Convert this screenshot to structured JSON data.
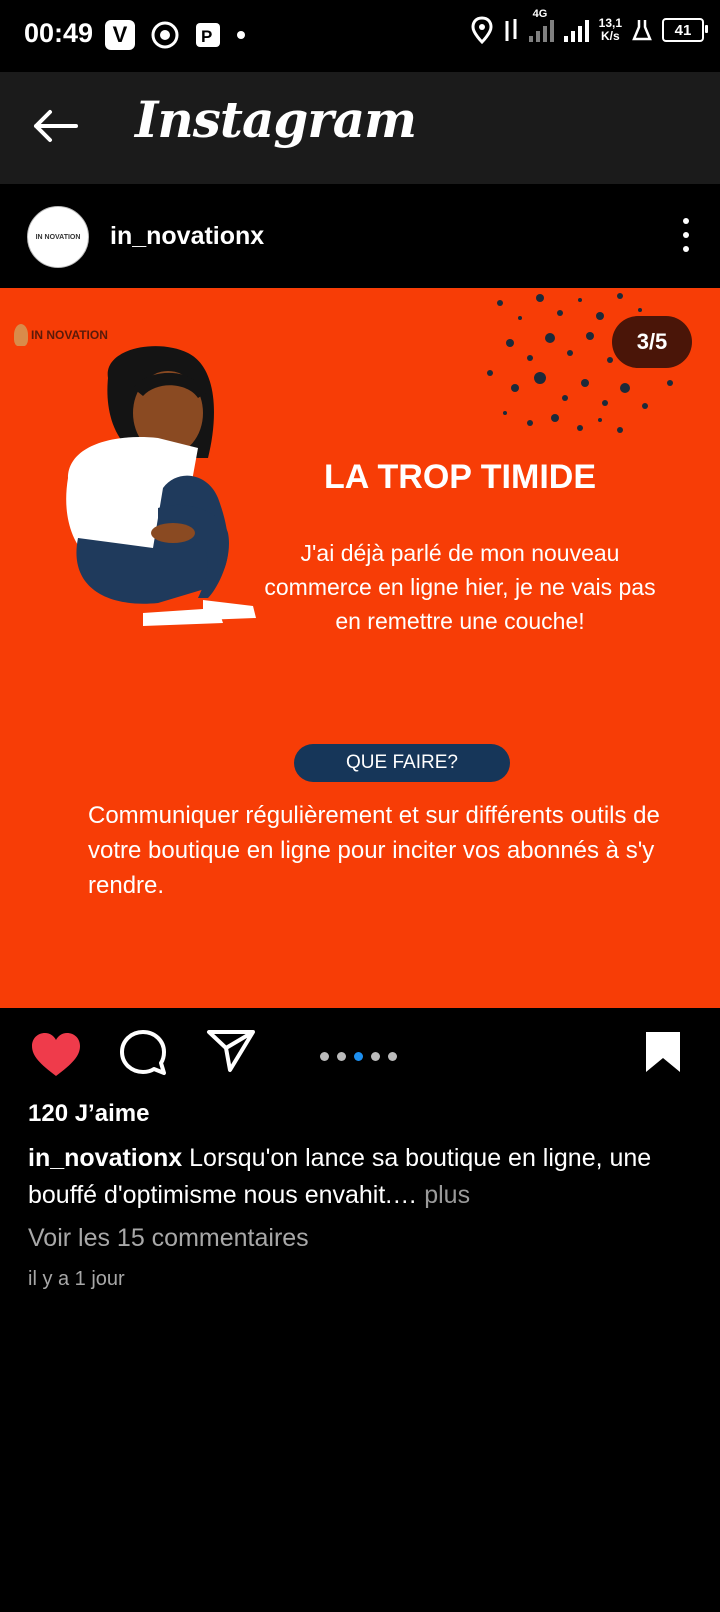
{
  "status_bar": {
    "time": "00:49",
    "speed_top": "13,1",
    "speed_bottom": "K/s",
    "network": "4G",
    "battery": "41",
    "icons": [
      "vimeo-icon",
      "chrome-icon",
      "parking-icon",
      "location-icon",
      "data-arrows-icon",
      "signal-icon",
      "lab-icon",
      "battery-icon"
    ]
  },
  "app_bar": {
    "title": "Instagram",
    "back_icon": "back-arrow-icon"
  },
  "post_header": {
    "username": "in_novationx",
    "avatar_text": "IN NOVATION",
    "more_icon": "more-vertical-icon"
  },
  "post": {
    "logo_text": "IN NOVATION",
    "counter": "3/5",
    "title": "LA TROP TIMIDE",
    "body": "J'ai déjà parlé de mon nouveau commerce en ligne hier, je ne vais pas en remettre une couche!",
    "pill": "QUE FAIRE?",
    "tip": "Communiquer régulièrement et sur différents outils de votre boutique en ligne pour inciter vos abonnés à s'y rendre.",
    "background": "#f73d06",
    "pill_color": "#163659"
  },
  "actions": {
    "icons": [
      "heart-icon",
      "comment-icon",
      "share-icon",
      "bookmark-icon"
    ],
    "liked": true,
    "carousel_total": 5,
    "carousel_active": 3
  },
  "likes": "120 J’aime",
  "caption": {
    "username": "in_novationx",
    "text": "Lorsqu'on lance sa boutique en ligne, une bouffé d'optimisme nous envahit.…",
    "more": "plus"
  },
  "comments_link": "Voir les 15 commentaires",
  "timestamp": "il y a 1 jour"
}
